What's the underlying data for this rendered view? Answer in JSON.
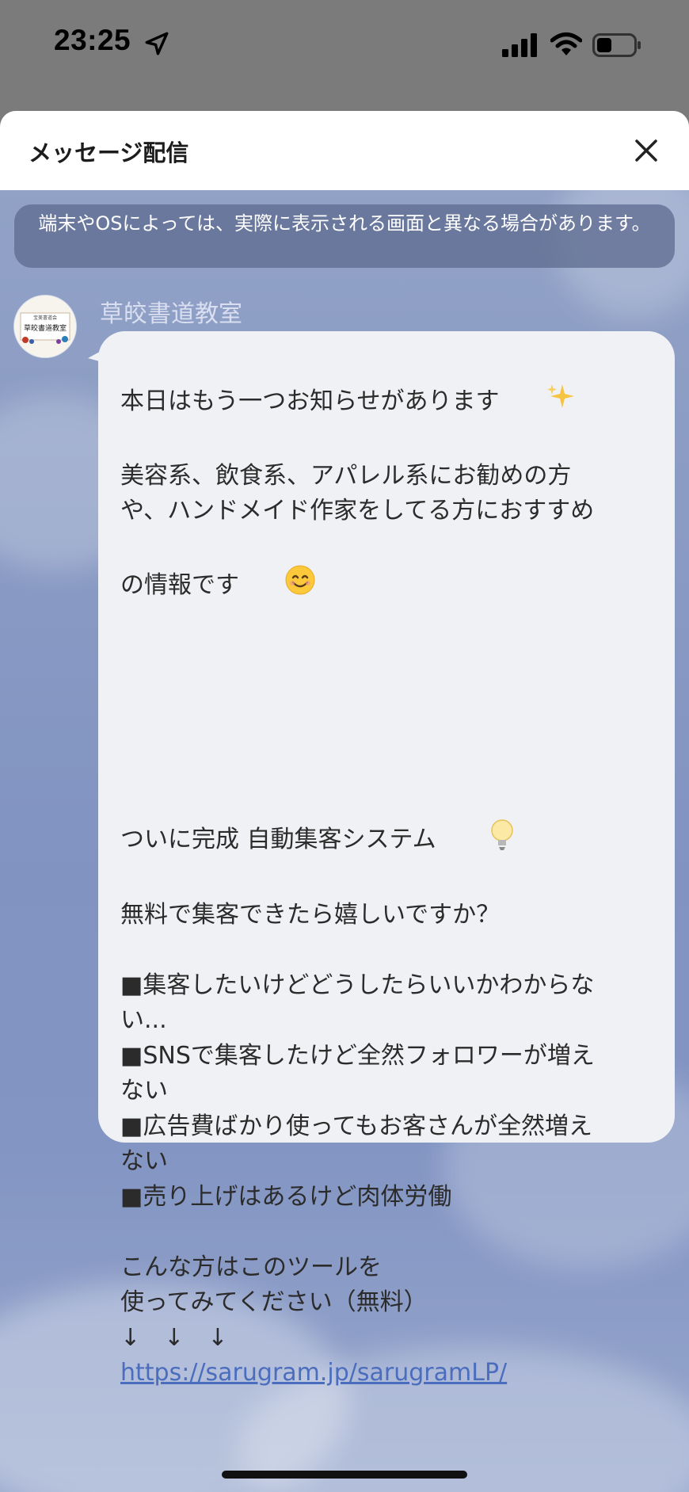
{
  "status_bar": {
    "time": "23:25"
  },
  "sheet": {
    "title": "メッセージ配信",
    "notice": "端末やOSによっては、実際に表示される画面と異なる場合があります。"
  },
  "message": {
    "sender": "草皎書道教室",
    "avatar_text_top": "宝美書道会",
    "avatar_text_main": "草皎書道教室",
    "line1": "本日はもう一つお知らせがあります",
    "line2": "美容系、飲食系、アパレル系にお勧めの方",
    "line3": "や、ハンドメイド作家をしてる方におすすめ",
    "line4": "の情報です",
    "line5": "ついに完成 自動集客システム",
    "line6": "無料で集客できたら嬉しいですか？",
    "line7": "■集客したいけどどうしたらいいかわからな",
    "line8": "い...",
    "line9": "■SNSで集客したけど全然フォロワーが増え",
    "line10": "ない",
    "line11": "■広告費ばかり使ってもお客さんが全然増え",
    "line12": "ない",
    "line13": "■売り上げはあるけど肉体労働",
    "line14": "こんな方はこのツールを",
    "line15": "使ってみてください（無料）",
    "line16": "↓　↓　↓",
    "link": "https://sarugram.jp/sarugramLP/"
  },
  "icons": {
    "sparkles": "sparkles-icon",
    "smile": "smile-emoji-icon",
    "lightbulb": "lightbulb-icon",
    "close": "close-icon",
    "location": "location-arrow-icon",
    "signal": "cellular-signal-icon",
    "wifi": "wifi-icon",
    "battery": "battery-icon"
  },
  "colors": {
    "status_bar": "#7b7b7b",
    "bubble": "#f0f1f4",
    "link": "#4a6dbd",
    "notice_bg": "#5a688c"
  }
}
